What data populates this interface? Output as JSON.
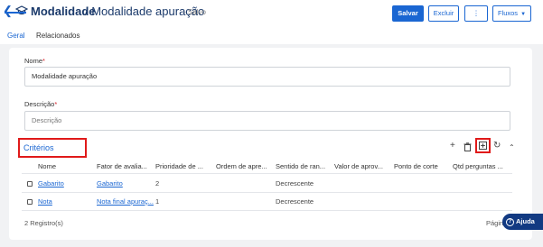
{
  "header": {
    "title_main": "Modalidade",
    "title_sub": "/ Modalidade apuração",
    "status": "- Salvo",
    "buttons": {
      "save": "Salvar",
      "delete": "Excluir",
      "more": "⋮",
      "flows": "Fluxos"
    }
  },
  "tabs": [
    {
      "label": "Geral",
      "active": true
    },
    {
      "label": "Relacionados",
      "active": false
    }
  ],
  "form": {
    "nome_label": "Nome",
    "nome_value": "Modalidade apuração",
    "descricao_label": "Descrição",
    "descricao_placeholder": "Descrição"
  },
  "criterios": {
    "title": "Critérios",
    "columns": [
      "Nome",
      "Fator de avalia...",
      "Prioridade de ...",
      "Ordem de apre...",
      "Sentido de ran...",
      "Valor de aprov...",
      "Ponto de corte",
      "Qtd perguntas ..."
    ],
    "rows": [
      {
        "nome": "Gabarito",
        "fator": "Gabarito",
        "prioridade": "2",
        "sentido": "Decrescente"
      },
      {
        "nome": "Nota",
        "fator": "Nota final apuraç...",
        "prioridade": "1",
        "sentido": "Decrescente"
      }
    ],
    "record_count": "2 Registro(s)",
    "page_label": "Págin"
  },
  "help": {
    "label": "Ajuda"
  },
  "colors": {
    "accent": "#1a66d2",
    "highlight": "#e01a1a",
    "help_bg": "#123a82"
  }
}
